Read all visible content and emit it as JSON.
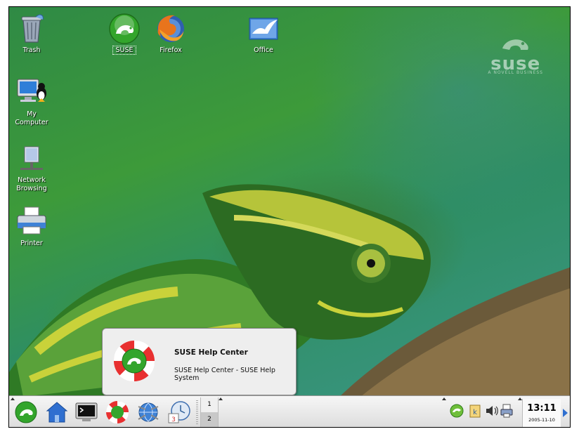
{
  "desktop": {
    "icons": [
      {
        "label": "Trash",
        "icon": "trash-icon"
      },
      {
        "label": "SUSE",
        "icon": "suse-gecko-icon"
      },
      {
        "label": "Firefox",
        "icon": "firefox-icon"
      },
      {
        "label": "Office",
        "icon": "office-icon"
      },
      {
        "label": "My\nComputer",
        "icon": "computer-icon"
      },
      {
        "label": "Network\nBrowsing",
        "icon": "network-icon"
      },
      {
        "label": "Printer",
        "icon": "printer-icon"
      }
    ],
    "wallpaper_logo": {
      "text": "suse",
      "subtext": "A NOVELL BUSINESS"
    }
  },
  "notification": {
    "title": "SUSE Help Center",
    "description": "SUSE Help Center - SUSE Help System",
    "icon": "help-lifebuoy-icon"
  },
  "panel": {
    "launchers": [
      "suse-menu-icon",
      "home-icon",
      "terminal-icon",
      "help-center-icon",
      "network-globe-icon",
      "calendar-icon"
    ],
    "pager": {
      "desktops": [
        "1",
        "2"
      ],
      "active": "2"
    },
    "tray": [
      "zen-updater-icon",
      "klipper-icon",
      "volume-icon",
      "printer-tray-icon"
    ],
    "clock": {
      "time": "13:11",
      "date": "2005-11-10"
    }
  },
  "colors": {
    "accent": "#2f6fd0",
    "suse_green": "#33a52c",
    "panel_bg": "#e8e8e8"
  }
}
